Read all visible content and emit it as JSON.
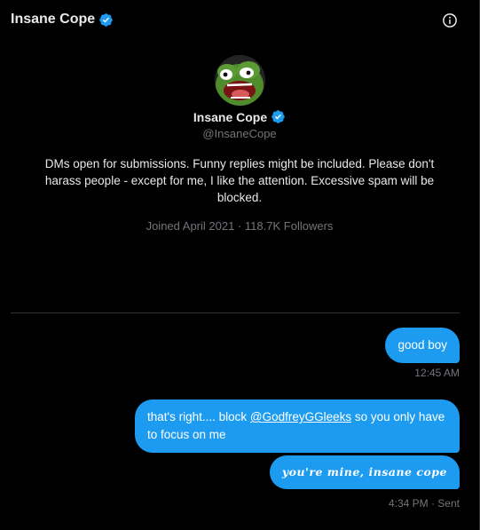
{
  "header": {
    "title": "Insane Cope",
    "verified_icon": "verified-badge-icon",
    "info_icon": "info-icon"
  },
  "profile": {
    "avatar_icon": "pepe-frog-avatar",
    "name": "Insane Cope",
    "handle": "@InsaneCope",
    "bio": "DMs open for submissions. Funny replies might be included. Please don't harass people - except for me, I like the attention. Excessive spam will be blocked.",
    "joined": "Joined April 2021",
    "separator": "·",
    "followers": "118.7K Followers"
  },
  "messages": [
    {
      "text": "good boy",
      "timestamp": "12:45 AM"
    },
    {
      "text_before": "that's right.... block ",
      "mention": "@GodfreyGGleeks",
      "text_after": " so you only have to focus on me"
    },
    {
      "text": "you're mine, insane cope",
      "timestamp": "4:34 PM · Sent"
    }
  ],
  "colors": {
    "background": "#000000",
    "bubble": "#1d9bf0",
    "verified": "#1d9bf0",
    "muted_text": "#71767b",
    "divider": "#2f3336"
  }
}
